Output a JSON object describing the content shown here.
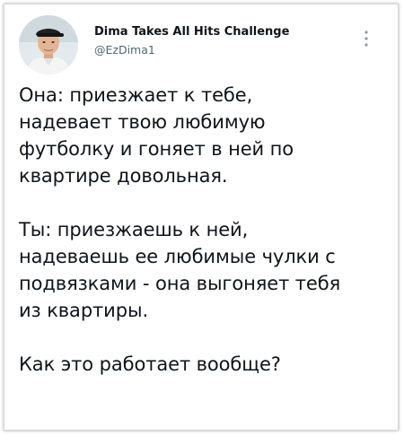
{
  "author": {
    "display_name": "Dima Takes All Hits Challenge",
    "handle": "@EzDima1"
  },
  "icons": {
    "avatar": "user-photo-avatar",
    "more": "more-options-vertical-dots-icon"
  },
  "colors": {
    "text": "#0f1419",
    "secondary_text": "#536471",
    "background": "#ffffff"
  },
  "tweet": {
    "paragraphs": [
      {
        "lines": [
          "Она: приезжает к тебе,",
          "надевает твою любимую",
          "футболку и гоняет в ней по",
          "квартире довольная."
        ]
      },
      {
        "lines": [
          "Ты: приезжаешь к ней,",
          "надеваешь ее любимые чулки с",
          "подвязками - она выгоняет тебя",
          "из квартиры."
        ]
      },
      {
        "lines": [
          "Как это работает вообще?"
        ]
      }
    ]
  }
}
